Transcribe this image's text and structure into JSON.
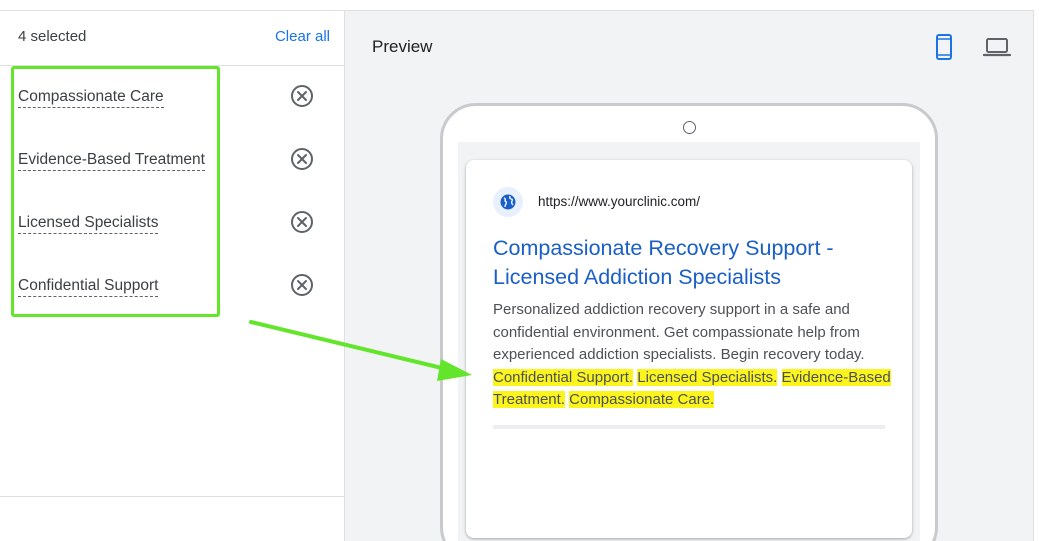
{
  "selection": {
    "count_label": "4 selected",
    "clear_label": "Clear all",
    "items": [
      {
        "label": "Compassionate Care"
      },
      {
        "label": "Evidence-Based Treatment"
      },
      {
        "label": "Licensed Specialists"
      },
      {
        "label": "Confidential Support"
      }
    ]
  },
  "preview": {
    "title": "Preview",
    "devices": [
      "mobile-icon",
      "laptop-icon"
    ],
    "ad": {
      "url": "https://www.yourclinic.com/",
      "headline_line1": "Compassionate Recovery Support -",
      "headline_line2": "Licensed Addiction Specialists",
      "description": "Personalized addiction recovery support in a safe and confidential environment. Get compassionate help from experienced addiction specialists. Begin recovery today.",
      "callouts": [
        "Confidential Support.",
        "Licensed Specialists.",
        "Evidence-Based Treatment.",
        "Compassionate Care."
      ]
    }
  },
  "colors": {
    "accent": "#1a73e8",
    "highlight": "#fbf51d",
    "annotation_green": "#62e52b",
    "headline": "#1a5fc7"
  }
}
